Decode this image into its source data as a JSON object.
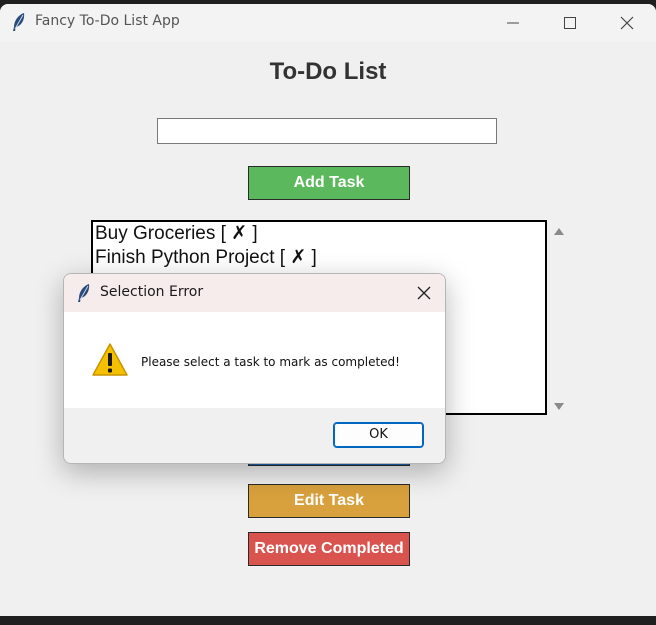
{
  "window": {
    "title": "Fancy To-Do List App",
    "heading": "To-Do List"
  },
  "input": {
    "value": "",
    "placeholder": ""
  },
  "buttons": {
    "add_task": "Add Task",
    "mark_completed": "",
    "edit_task": "Edit Task",
    "remove_completed": "Remove Completed"
  },
  "tasks": [
    {
      "label": "Buy Groceries [ ✗ ]"
    },
    {
      "label": "Finish Python Project [ ✗ ]"
    }
  ],
  "dialog": {
    "title": "Selection Error",
    "message": "Please select a task to mark as completed!",
    "ok_label": "OK",
    "icon": "warning-icon"
  },
  "colors": {
    "add_button": "#5cb85c",
    "mark_button": "#1d62b0",
    "edit_button": "#d9a13d",
    "remove_button": "#d9534f",
    "warning_icon": "#f5c000"
  }
}
